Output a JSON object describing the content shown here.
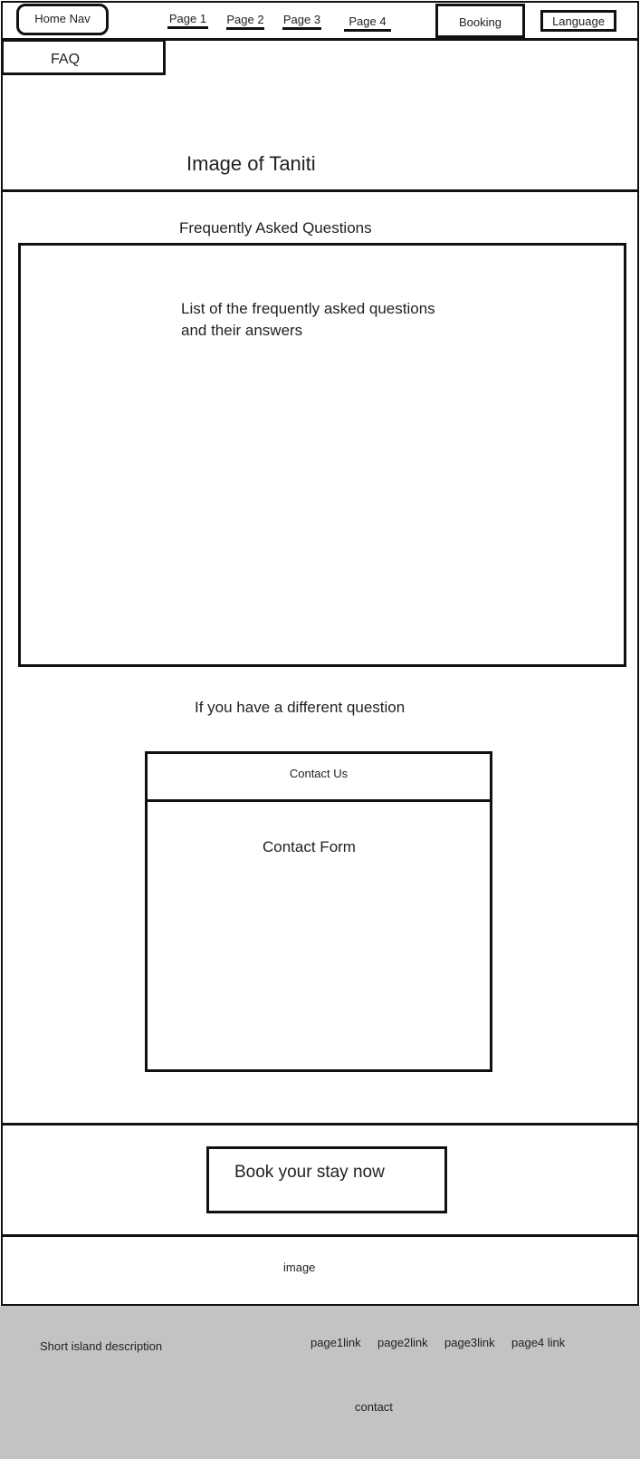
{
  "header": {
    "home_nav_label": "Home Nav",
    "nav_links": [
      "Page 1",
      "Page 2",
      "Page 3",
      "Page 4"
    ],
    "booking_label": "Booking",
    "language_label": "Language"
  },
  "faq_tab": {
    "label": "FAQ"
  },
  "hero": {
    "caption": "Image of Taniti"
  },
  "faq_section": {
    "heading": "Frequently Asked Questions",
    "list_placeholder_line1": "List of the frequently asked questions",
    "list_placeholder_line2": "and their answers"
  },
  "contact_section": {
    "prompt": "If you have a different question",
    "contact_us_label": "Contact Us",
    "form_label": "Contact Form"
  },
  "booking_cta": {
    "label": "Book your stay now"
  },
  "image_section": {
    "caption": "image"
  },
  "footer": {
    "description": "Short island description",
    "links": [
      "page1link",
      "page2link",
      "page3link",
      "page4 link"
    ],
    "contact_label": "contact"
  }
}
